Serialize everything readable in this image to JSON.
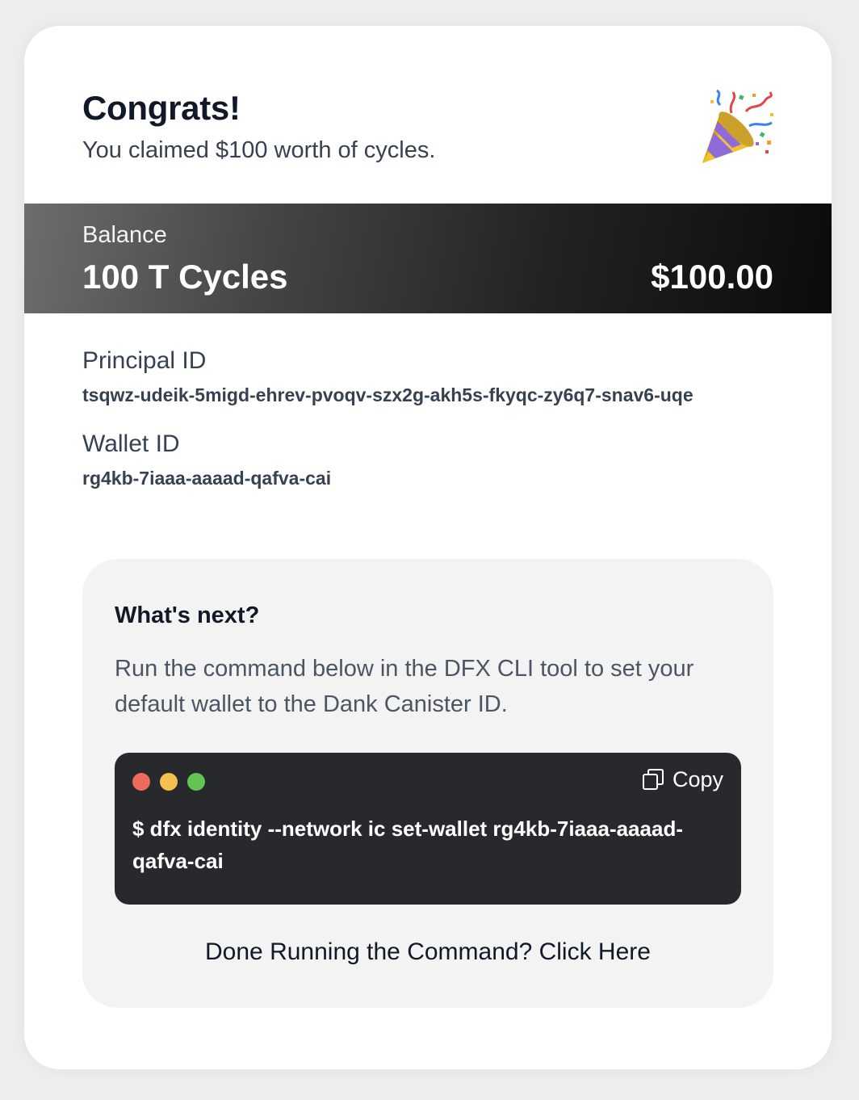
{
  "header": {
    "title": "Congrats!",
    "subtitle": "You claimed $100 worth of cycles.",
    "icon": "party-popper-icon"
  },
  "balance": {
    "label": "Balance",
    "cycles": "100 T Cycles",
    "usd": "$100.00"
  },
  "principal": {
    "label": "Principal ID",
    "value": "tsqwz-udeik-5migd-ehrev-pvoqv-szx2g-akh5s-fkyqc-zy6q7-snav6-uqe"
  },
  "wallet": {
    "label": "Wallet ID",
    "value": "rg4kb-7iaaa-aaaad-qafva-cai"
  },
  "next": {
    "title": "What's next?",
    "description": "Run the command below in the DFX CLI tool to set your default wallet to the Dank Canister ID.",
    "copy_label": "Copy",
    "command": "$ dfx identity --network ic set-wallet rg4kb-7iaaa-aaaad-qafva-cai",
    "done_label": "Done Running the Command? Click Here"
  },
  "colors": {
    "terminal_bg": "#27292c",
    "dot_red": "#ec6a5e",
    "dot_yellow": "#f4bf4f",
    "dot_green": "#61c554"
  }
}
